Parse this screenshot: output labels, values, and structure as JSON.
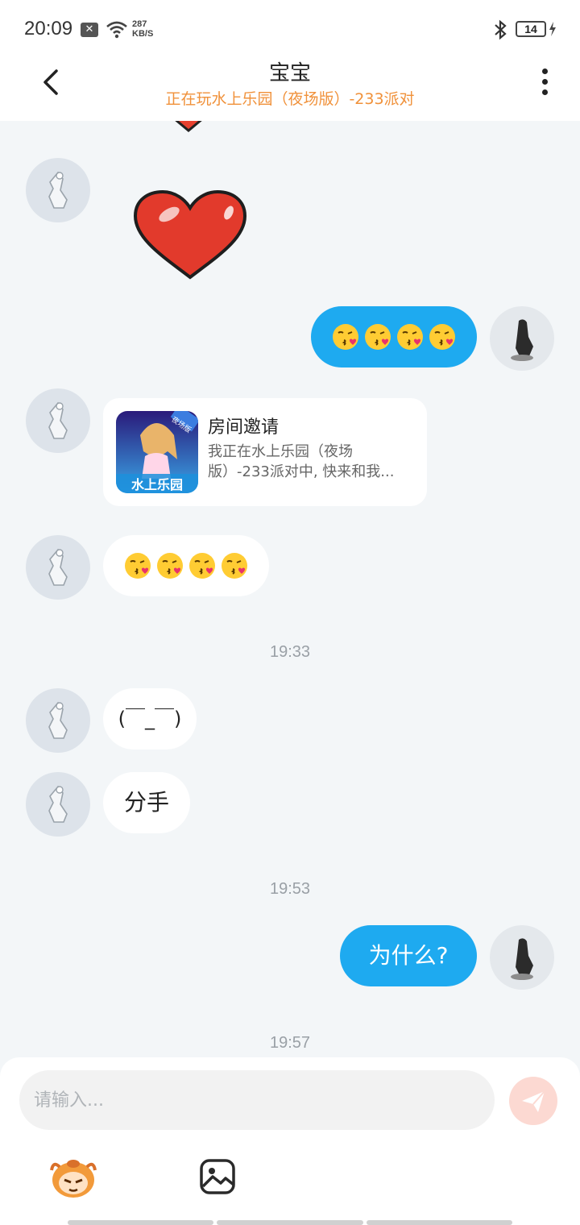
{
  "status_bar": {
    "time": "20:09",
    "net_speed_value": "287",
    "net_speed_unit": "KB/S",
    "battery": "14"
  },
  "header": {
    "title": "宝宝",
    "subtitle": "正在玩水上乐园（夜场版）-233派对"
  },
  "messages": {
    "sent_emoji": "😘😘😘😘",
    "invite": {
      "image_label": "水上乐园",
      "image_badge": "夜场版",
      "title": "房间邀请",
      "desc": "我正在水上乐园（夜场版）-233派对中, 快来和我..."
    },
    "received_emoji": "😘😘😘😘",
    "time_1": "19:33",
    "kaomoji": "(￣_￣)",
    "breakup": "分手",
    "time_2": "19:53",
    "why": "为什么?",
    "time_3": "19:57"
  },
  "input": {
    "placeholder": "请输入..."
  },
  "colors": {
    "accent": "#1eaaf0",
    "subtitle": "#f0913a",
    "send_button": "#fcd9d2"
  }
}
